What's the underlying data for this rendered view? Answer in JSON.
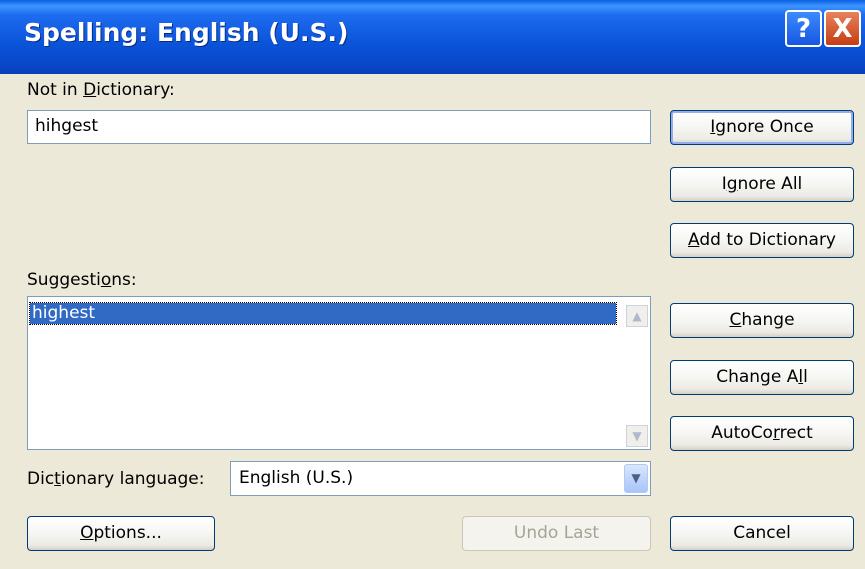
{
  "window": {
    "title": "Spelling: English (U.S.)",
    "help_label": "?",
    "close_label": "X"
  },
  "not_in_dictionary": {
    "label_pre": "Not in ",
    "label_key": "D",
    "label_post": "ictionary:",
    "value": "hihgest"
  },
  "suggestions": {
    "label_pre": "Suggesti",
    "label_key": "o",
    "label_post": "ns:",
    "items": [
      "highest"
    ],
    "selected_index": 0
  },
  "dictionary_language": {
    "label_pre": "Dic",
    "label_key": "t",
    "label_post": "ionary language:",
    "value": "English (U.S.)"
  },
  "buttons": {
    "ignore_once": {
      "pre": "",
      "key": "I",
      "post": "gnore Once"
    },
    "ignore_all": {
      "pre": "I",
      "key": "g",
      "post": "nore All"
    },
    "add_to_dictionary": {
      "pre": "",
      "key": "A",
      "post": "dd to Dictionary"
    },
    "change": {
      "pre": "",
      "key": "C",
      "post": "hange"
    },
    "change_all": {
      "pre": "Change A",
      "key": "l",
      "post": "l"
    },
    "autocorrect": {
      "pre": "AutoCo",
      "key": "r",
      "post": "rect"
    },
    "options": {
      "pre": "",
      "key": "O",
      "post": "ptions..."
    },
    "undo_last": {
      "label": "Undo Last",
      "enabled": false
    },
    "cancel": {
      "label": "Cancel"
    }
  },
  "colors": {
    "dialog_bg": "#ECE9D8",
    "titlebar": "#0A53D8",
    "selection": "#316AC5",
    "close_button": "#C53D14"
  },
  "icons": {
    "help": "help-button",
    "close": "close-icon",
    "scroll_up": "chevron-up-icon",
    "scroll_down": "chevron-down-icon",
    "dropdown": "chevron-down-icon"
  }
}
